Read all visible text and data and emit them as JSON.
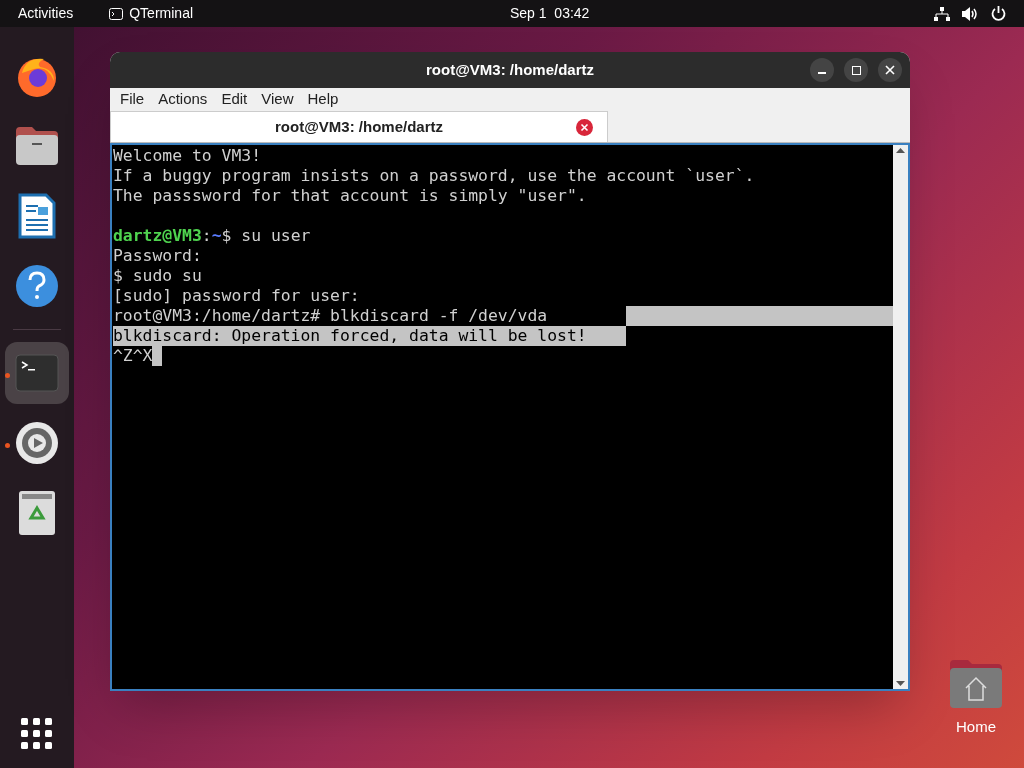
{
  "top_bar": {
    "activities": "Activities",
    "app_name": "QTerminal",
    "clock": "Sep 1  03:42"
  },
  "dock": {
    "groups": [
      {
        "items": [
          {
            "kind": "firefox",
            "running": false,
            "selected": false
          },
          {
            "kind": "files",
            "running": false,
            "selected": false
          },
          {
            "kind": "writer",
            "running": false,
            "selected": false
          },
          {
            "kind": "help",
            "running": false,
            "selected": false
          }
        ]
      },
      {
        "items": [
          {
            "kind": "terminal",
            "running": true,
            "selected": true
          },
          {
            "kind": "settings",
            "running": true,
            "selected": false
          },
          {
            "kind": "trash",
            "running": false,
            "selected": false
          }
        ]
      }
    ]
  },
  "window": {
    "title": "root@VM3: /home/dartz",
    "menu": [
      "File",
      "Actions",
      "Edit",
      "View",
      "Help"
    ],
    "tabs": [
      {
        "label": "root@VM3: /home/dartz",
        "selected": true
      }
    ],
    "terminal_lines": [
      {
        "segments": [
          {
            "text": "Welcome to VM3!",
            "kind": "plain"
          }
        ],
        "head_selected": false,
        "tail_selected": false,
        "cursor": false
      },
      {
        "segments": [
          {
            "text": "If a buggy program insists on a password, use the account `user`.",
            "kind": "plain"
          }
        ],
        "head_selected": false,
        "tail_selected": false,
        "cursor": false
      },
      {
        "segments": [
          {
            "text": "The passsword for that account is simply \"user\".",
            "kind": "plain"
          }
        ],
        "head_selected": false,
        "tail_selected": false,
        "cursor": false
      },
      {
        "head_selected": false,
        "tail_selected": false,
        "cursor": false
      },
      {
        "segments": [
          {
            "text": "dartz@VM3",
            "kind": "user"
          },
          {
            "text": ":",
            "kind": "plain"
          },
          {
            "text": "~",
            "kind": "path"
          },
          {
            "text": "$ su user",
            "kind": "plain"
          }
        ],
        "head_selected": false,
        "tail_selected": false,
        "cursor": false
      },
      {
        "segments": [
          {
            "text": "Password:",
            "kind": "plain"
          }
        ],
        "head_selected": false,
        "tail_selected": false,
        "cursor": false
      },
      {
        "segments": [
          {
            "text": "$ sudo su",
            "kind": "plain"
          }
        ],
        "head_selected": false,
        "tail_selected": false,
        "cursor": false
      },
      {
        "segments": [
          {
            "text": "[sudo] password for user:",
            "kind": "plain"
          }
        ],
        "head_selected": false,
        "tail_selected": false,
        "cursor": false
      },
      {
        "segments": [
          {
            "text": "root@VM3:/home/dartz# blkdiscard -f /dev/vda",
            "kind": "plain"
          }
        ],
        "head_selected": false,
        "tail_selected": true,
        "cursor": false
      },
      {
        "segments": [
          {
            "text": "blkdiscard: Operation forced, data will be lost!",
            "kind": "plain"
          }
        ],
        "head_selected": true,
        "tail_selected": false,
        "cursor": false
      },
      {
        "segments": [
          {
            "text": "^Z^X",
            "kind": "plain"
          }
        ],
        "head_selected": false,
        "tail_selected": false,
        "cursor": true
      }
    ]
  },
  "desktop_icons": [
    {
      "label": "Home"
    }
  ]
}
